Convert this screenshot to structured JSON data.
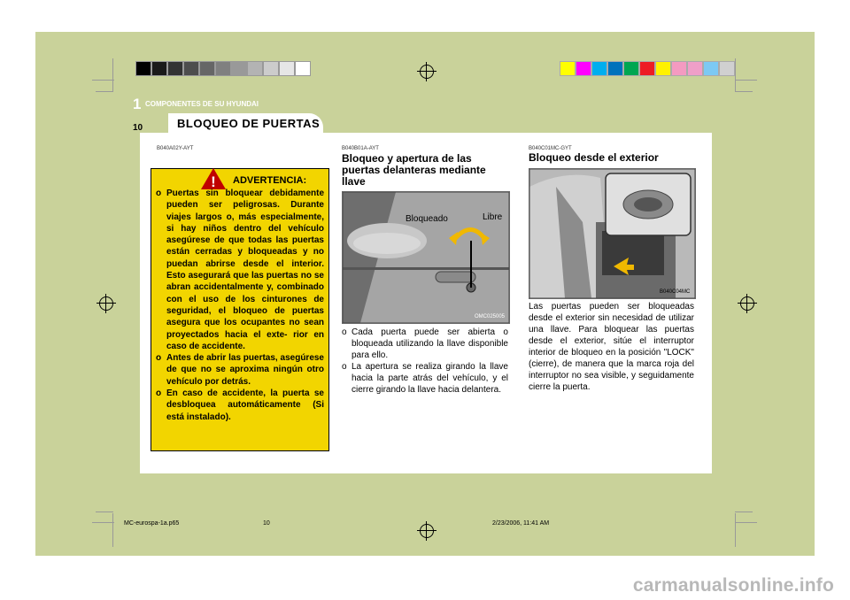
{
  "header": {
    "section_number": "1",
    "section_title": "COMPONENTES DE SU HYUNDAI",
    "page_number": "10",
    "tab_title": "BLOQUEO DE PUERTAS"
  },
  "color_bar_left": [
    "#000000",
    "#1a1a1a",
    "#333333",
    "#4d4d4d",
    "#666666",
    "#808080",
    "#999999",
    "#b3b3b3",
    "#cccccc",
    "#e6e6e6",
    "#ffffff"
  ],
  "color_bar_right": [
    "#ffff00",
    "#ff00ff",
    "#00aeef",
    "#0072bc",
    "#00a651",
    "#ed1c24",
    "#fff200",
    "#f49ac1",
    "#ef9fc8",
    "#7cc9f3",
    "#d0d0d0"
  ],
  "warning": {
    "code": "B040A02Y-AYT",
    "title": "ADVERTENCIA:",
    "items": [
      "Puertas sin bloquear debidamente pueden ser peligrosas. Durante viajes largos o, más especialmente, si hay niños dentro del vehículo asegúrese de que todas las puertas están cerradas y bloqueadas y no puedan abrirse desde el interior. Esto asegurará que las puertas no se abran accidentalmente y, combinado con el uso de los cinturones de seguridad, el bloqueo de puertas asegura que los ocupantes no sean proyectados hacia el exte- rior en caso de accidente.",
      "Antes de abrir las puertas, asegúrese de que no se aproxima ningún otro vehículo por detrás.",
      "En caso de accidente, la puerta se desbloquea automáticamente (Si está instalado)."
    ]
  },
  "middle": {
    "code": "B040B01A-AYT",
    "heading": "Bloqueo y apertura de las puertas delanteras mediante llave",
    "image_label_lock": "Bloqueado",
    "image_label_unlock": "Libre",
    "image_code": "OMC025005",
    "items": [
      "Cada puerta puede ser abierta o bloqueada utilizando la llave disponible para ello.",
      "La apertura se realiza girando la llave hacia la parte atrás del vehículo, y el cierre girando la llave hacia delantera."
    ]
  },
  "right": {
    "code": "B040C01MC-GYT",
    "heading": "Bloqueo desde el exterior",
    "image_code": "B040C04MC",
    "body": "Las puertas pueden ser bloqueadas desde el exterior sin necesidad de utilizar una llave. Para bloquear las puertas desde el exterior, sitúe el interruptor interior de bloqueo en la posición \"LOCK\" (cierre), de manera que la marca roja del interruptor no sea visible, y seguidamente cierre la puerta."
  },
  "footer": {
    "file": "MC-eurospa-1a.p65",
    "page": "10",
    "timestamp": "2/23/2006, 11:41 AM"
  },
  "watermark": "carmanualsonline.info",
  "bullet": "o"
}
